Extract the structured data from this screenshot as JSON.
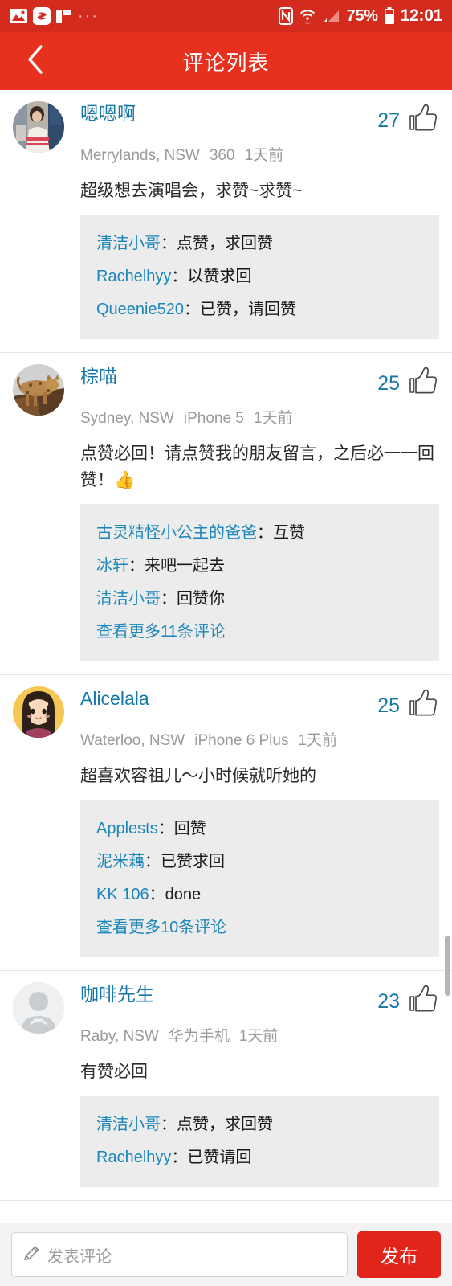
{
  "statusbar": {
    "icons": [
      "image-icon",
      "today-app-icon",
      "flipboard-icon",
      "more-dots-icon",
      "nfc-icon",
      "wifi-icon",
      "signal-icon"
    ],
    "battery_percent": "75%",
    "clock": "12:01",
    "bg_color": "#d32b1e"
  },
  "appbar": {
    "title": "评论列表",
    "back_icon": "chevron-left-icon",
    "bg_color": "#e8301f"
  },
  "theme": {
    "accent_red": "#e1251b",
    "link_blue": "#1678a8",
    "reply_blue": "#1a86ba",
    "reply_bg": "#ececec",
    "meta_gray": "#9a9a9a"
  },
  "comments": [
    {
      "avatar": "photo-woman-avatar",
      "name": "嗯嗯啊",
      "like_count": "27",
      "like_icon": "thumbs-up-icon",
      "location": "Merrylands, NSW",
      "device": "360",
      "time": "1天前",
      "body": "超级想去演唱会，求赞~求赞~",
      "replies": [
        {
          "user": "清洁小哥",
          "text": "点赞，求回赞"
        },
        {
          "user": "Rachelhyy",
          "text": "以赞求回"
        },
        {
          "user": "Queenie520",
          "text": "已赞，请回赞"
        }
      ],
      "more_label": ""
    },
    {
      "avatar": "photo-cat-avatar",
      "name": "棕喵",
      "like_count": "25",
      "like_icon": "thumbs-up-icon",
      "location": "Sydney, NSW",
      "device": "iPhone 5",
      "time": "1天前",
      "body": "点赞必回！请点赞我的朋友留言，之后必一一回赞！👍",
      "replies": [
        {
          "user": "古灵精怪小公主的爸爸",
          "text": "互赞"
        },
        {
          "user": "冰轩",
          "text": "来吧一起去"
        },
        {
          "user": "清洁小哥",
          "text": "回赞你"
        }
      ],
      "more_label": "查看更多11条评论"
    },
    {
      "avatar": "cartoon-girl-avatar",
      "name": "Alicelala",
      "like_count": "25",
      "like_icon": "thumbs-up-icon",
      "location": "Waterloo, NSW",
      "device": "iPhone 6 Plus",
      "time": "1天前",
      "body": "超喜欢容祖儿〜小时候就听她的",
      "replies": [
        {
          "user": "Applests",
          "text": "回赞"
        },
        {
          "user": "泥米藕",
          "text": "已赞求回"
        },
        {
          "user": "KK 106",
          "text": "done"
        }
      ],
      "more_label": "查看更多10条评论"
    },
    {
      "avatar": "default-person-avatar",
      "name": "咖啡先生",
      "like_count": "23",
      "like_icon": "thumbs-up-icon",
      "location": "Raby, NSW",
      "device": "华为手机",
      "time": "1天前",
      "body": "有赞必回",
      "replies": [
        {
          "user": "清洁小哥",
          "text": "点赞，求回赞"
        },
        {
          "user": "Rachelhyy",
          "text": "已赞请回"
        }
      ],
      "more_label": ""
    }
  ],
  "compose": {
    "pencil_icon": "pencil-icon",
    "placeholder": "发表评论",
    "value": "",
    "post_label": "发布"
  }
}
